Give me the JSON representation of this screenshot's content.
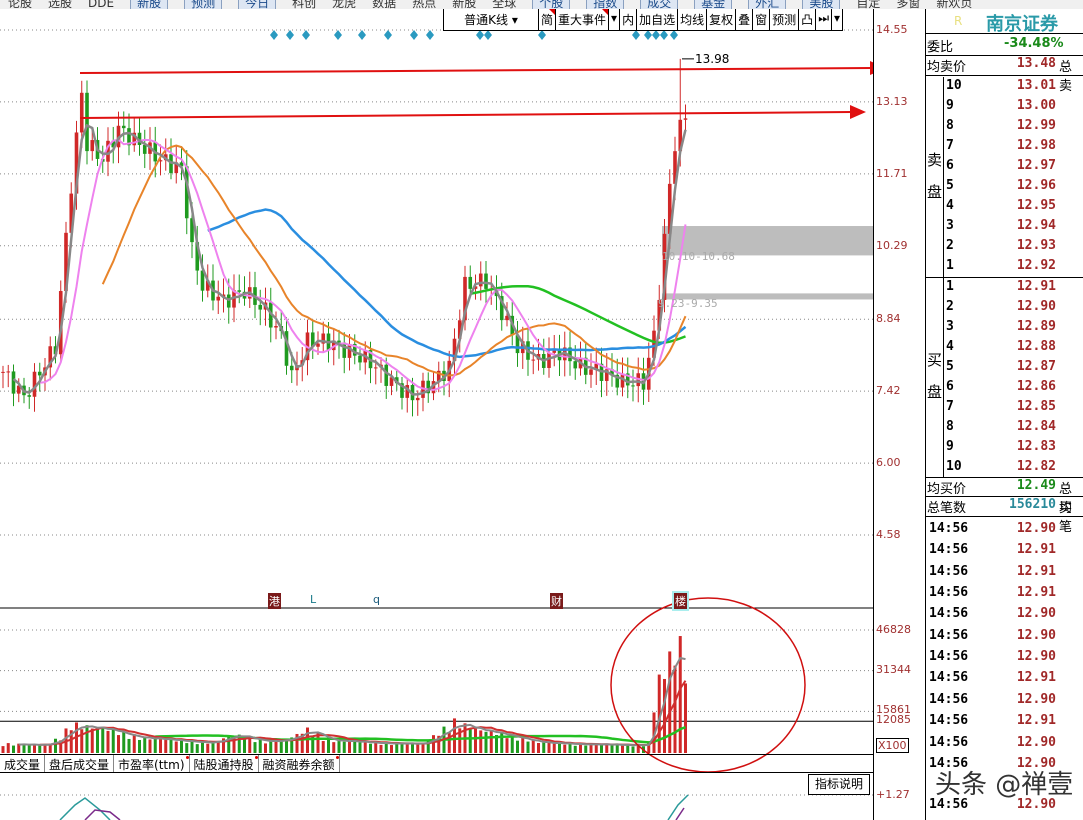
{
  "top_nav": [
    {
      "label": "论股",
      "btn": false
    },
    {
      "label": "选股",
      "btn": false
    },
    {
      "label": "DDE",
      "btn": false
    },
    {
      "label": "新股",
      "btn": true
    },
    {
      "label": "预测",
      "btn": true
    },
    {
      "label": "今日",
      "btn": true
    },
    {
      "label": "科创",
      "btn": false
    },
    {
      "label": "龙虎",
      "btn": false
    },
    {
      "label": "数据",
      "btn": false
    },
    {
      "label": "热点",
      "btn": false
    },
    {
      "label": "新股",
      "btn": false
    },
    {
      "label": "全球",
      "btn": false
    },
    {
      "label": "个股",
      "btn": true
    },
    {
      "label": "指数",
      "btn": true
    },
    {
      "label": "成交",
      "btn": true
    },
    {
      "label": "基金",
      "btn": true
    },
    {
      "label": "外汇",
      "btn": true
    },
    {
      "label": "美股",
      "btn": true
    },
    {
      "label": "自定",
      "btn": false
    },
    {
      "label": "多窗",
      "btn": false
    },
    {
      "label": "新欢页",
      "btn": false
    }
  ],
  "toolbar": {
    "kline": "普通K线 ▾",
    "simple": "简",
    "events": "重大事件",
    "events_drop": "▾",
    "inner": "内",
    "add_fav": "加自选",
    "ma": "均线",
    "adjust": "复权",
    "overlay": "叠",
    "window": "窗",
    "forecast": "预测",
    "lock_icon": "凸",
    "next_icon": "⏭",
    "more": "▾"
  },
  "price_axis": [
    "14.55",
    "13.13",
    "11.71",
    "10.29",
    "8.84",
    "7.42",
    "6.00",
    "4.58"
  ],
  "volume_axis": [
    "46828",
    "31344",
    "15861",
    "12085",
    "X100"
  ],
  "indicator_axis": "+1.27",
  "event_markers": [
    "港",
    "L",
    "q",
    "财",
    "楼"
  ],
  "chart_data": {
    "type": "candlestick",
    "price_ticks": [
      14.55,
      13.13,
      11.71,
      10.29,
      8.84,
      7.42,
      6.0,
      4.58
    ],
    "ylim": [
      4.58,
      14.55
    ],
    "bars": 131,
    "close_path": [
      [
        0,
        7.8
      ],
      [
        4,
        7.3
      ],
      [
        10,
        8.3
      ],
      [
        13,
        11.5
      ],
      [
        15,
        13.3
      ],
      [
        16,
        12.3
      ],
      [
        19,
        12.0
      ],
      [
        22,
        12.6
      ],
      [
        26,
        12.3
      ],
      [
        30,
        12.0
      ],
      [
        34,
        11.8
      ],
      [
        36,
        10.2
      ],
      [
        38,
        9.5
      ],
      [
        42,
        9.2
      ],
      [
        46,
        9.4
      ],
      [
        50,
        9.0
      ],
      [
        53,
        8.5
      ],
      [
        55,
        7.7
      ],
      [
        58,
        8.4
      ],
      [
        62,
        8.4
      ],
      [
        66,
        8.2
      ],
      [
        70,
        8.0
      ],
      [
        74,
        7.6
      ],
      [
        78,
        7.3
      ],
      [
        82,
        7.6
      ],
      [
        85,
        7.9
      ],
      [
        88,
        9.5
      ],
      [
        92,
        9.6
      ],
      [
        95,
        9.0
      ],
      [
        98,
        8.3
      ],
      [
        102,
        8.0
      ],
      [
        106,
        8.2
      ],
      [
        110,
        7.9
      ],
      [
        114,
        7.8
      ],
      [
        118,
        7.6
      ],
      [
        122,
        7.6
      ],
      [
        124,
        8.5
      ],
      [
        125,
        9.4
      ],
      [
        126,
        10.4
      ],
      [
        127,
        11.5
      ],
      [
        128,
        12.3
      ],
      [
        129,
        12.6
      ],
      [
        130,
        12.9
      ]
    ],
    "high_label": "13.98",
    "high_value": 13.98,
    "zones": [
      {
        "label": "10.10-10.68",
        "low": 10.1,
        "high": 10.68
      },
      {
        "label": "9.23-9.35",
        "low": 9.23,
        "high": 9.35
      }
    ],
    "volume_ticks": [
      46828,
      31344,
      15861
    ],
    "volume_reference": 12085,
    "volume_path": [
      [
        0,
        3500
      ],
      [
        8,
        3000
      ],
      [
        11,
        6000
      ],
      [
        13,
        11000
      ],
      [
        16,
        10000
      ],
      [
        20,
        9000
      ],
      [
        26,
        6000
      ],
      [
        32,
        5000
      ],
      [
        40,
        4000
      ],
      [
        44,
        7000
      ],
      [
        50,
        4500
      ],
      [
        54,
        5000
      ],
      [
        58,
        9000
      ],
      [
        62,
        5000
      ],
      [
        70,
        4000
      ],
      [
        80,
        3500
      ],
      [
        86,
        12000
      ],
      [
        90,
        9000
      ],
      [
        96,
        7000
      ],
      [
        102,
        4000
      ],
      [
        110,
        3500
      ],
      [
        120,
        3000
      ],
      [
        123,
        3500
      ],
      [
        124,
        18000
      ],
      [
        125,
        28000
      ],
      [
        126,
        30000
      ],
      [
        127,
        38000
      ],
      [
        128,
        33000
      ],
      [
        129,
        46828
      ],
      [
        130,
        25000
      ]
    ],
    "ma_colors": {
      "ma5": "#888888",
      "ma10": "#ee82ee",
      "ma30": "#e8842a",
      "ma60": "#2a8ee0",
      "ma90": "#22c022"
    },
    "up_color": "#d02828",
    "down_color": "#1f9a1f"
  },
  "annotations": {
    "arrow_color": "#e01010",
    "circle_color": "#d01010"
  },
  "tabs": [
    {
      "label": "成交量",
      "dot": false
    },
    {
      "label": "盘后成交量",
      "dot": false
    },
    {
      "label": "市盈率(ttm)",
      "dot": true
    },
    {
      "label": "陆股通持股",
      "dot": true
    },
    {
      "label": "融资融券余额",
      "dot": true
    }
  ],
  "indicator_button": "指标说明",
  "right_panel": {
    "r_mark": "R",
    "broker": "南京证券",
    "ratio_label": "委比",
    "ratio_value": "-34.48%",
    "avg_sell_label": "均卖价",
    "avg_sell_value": "13.48",
    "total_sell_label": "总卖",
    "sell_side_label": [
      "卖",
      "盘"
    ],
    "sell": [
      {
        "level": "10",
        "price": "13.01"
      },
      {
        "level": "9",
        "price": "13.00"
      },
      {
        "level": "8",
        "price": "12.99"
      },
      {
        "level": "7",
        "price": "12.98"
      },
      {
        "level": "6",
        "price": "12.97"
      },
      {
        "level": "5",
        "price": "12.96"
      },
      {
        "level": "4",
        "price": "12.95"
      },
      {
        "level": "3",
        "price": "12.94"
      },
      {
        "level": "2",
        "price": "12.93"
      },
      {
        "level": "1",
        "price": "12.92"
      }
    ],
    "buy_side_label": [
      "买",
      "盘"
    ],
    "buy": [
      {
        "level": "1",
        "price": "12.91"
      },
      {
        "level": "2",
        "price": "12.90"
      },
      {
        "level": "3",
        "price": "12.89"
      },
      {
        "level": "4",
        "price": "12.88"
      },
      {
        "level": "5",
        "price": "12.87"
      },
      {
        "level": "6",
        "price": "12.86"
      },
      {
        "level": "7",
        "price": "12.85"
      },
      {
        "level": "8",
        "price": "12.84"
      },
      {
        "level": "9",
        "price": "12.83"
      },
      {
        "level": "10",
        "price": "12.82"
      }
    ],
    "avg_buy_label": "均买价",
    "avg_buy_value": "12.49",
    "total_buy_label": "总买",
    "trades_label": "总笔数",
    "trades_value": "156210",
    "avg_trade_label": "均笔",
    "ticks": [
      {
        "time": "14:56",
        "price": "12.90"
      },
      {
        "time": "14:56",
        "price": "12.91"
      },
      {
        "time": "14:56",
        "price": "12.91"
      },
      {
        "time": "14:56",
        "price": "12.91"
      },
      {
        "time": "14:56",
        "price": "12.90"
      },
      {
        "time": "14:56",
        "price": "12.90"
      },
      {
        "time": "14:56",
        "price": "12.90"
      },
      {
        "time": "14:56",
        "price": "12.91"
      },
      {
        "time": "14:56",
        "price": "12.90"
      },
      {
        "time": "14:56",
        "price": "12.91"
      },
      {
        "time": "14:56",
        "price": "12.90"
      },
      {
        "time": "14:56",
        "price": "12.90"
      },
      {
        "time": "14:56",
        "price": "12.90"
      }
    ]
  },
  "watermark": "头条 @禅壹"
}
